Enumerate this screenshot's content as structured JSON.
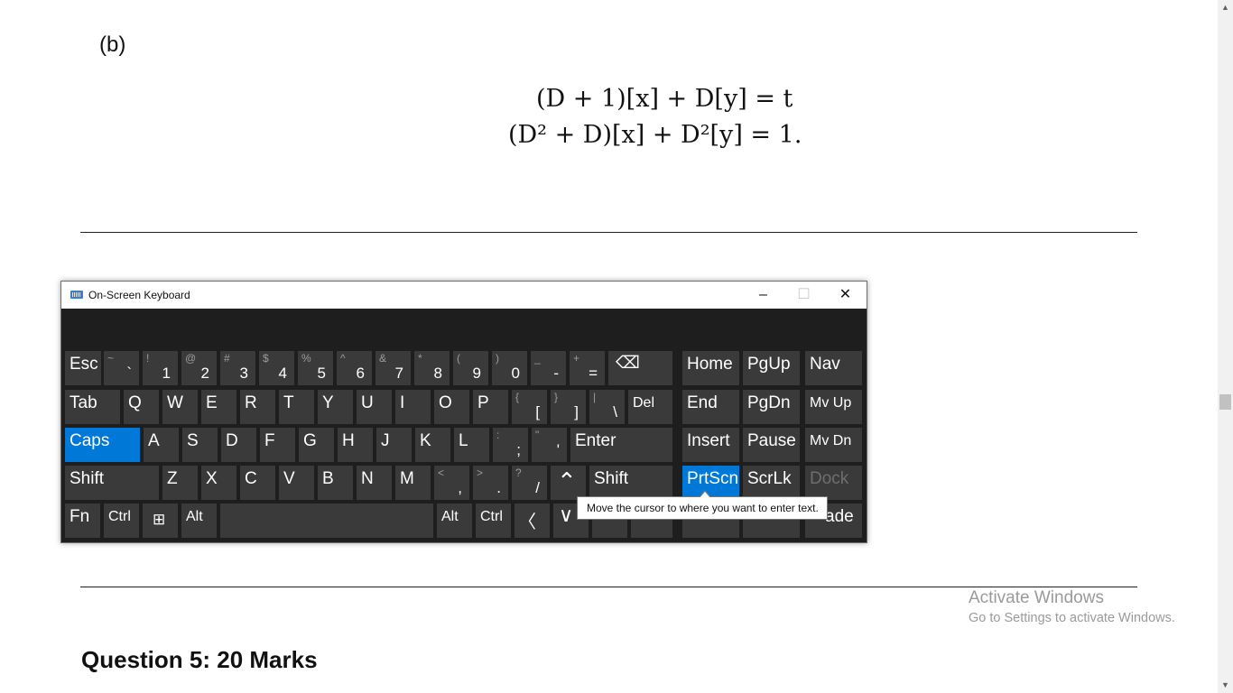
{
  "document": {
    "part_label": "(b)",
    "equation_1": "(D + 1)[x] + D[y] = t",
    "equation_2": "(D² + D)[x] + D²[y] = 1.",
    "question_heading": "Question 5: 20 Marks"
  },
  "watermark": {
    "line1": "Activate Windows",
    "line2": "Go to Settings to activate Windows."
  },
  "osk": {
    "title": "On-Screen Keyboard",
    "minimize": "–",
    "maximize": "☐",
    "close": "✕",
    "tooltip": "Move the cursor to where you want to enter text.",
    "keys": {
      "esc": "Esc",
      "backtick": {
        "sym": "~",
        "main": "`"
      },
      "n1": {
        "sym": "!",
        "main": "1"
      },
      "n2": {
        "sym": "@",
        "main": "2"
      },
      "n3": {
        "sym": "#",
        "main": "3"
      },
      "n4": {
        "sym": "$",
        "main": "4"
      },
      "n5": {
        "sym": "%",
        "main": "5"
      },
      "n6": {
        "sym": "^",
        "main": "6"
      },
      "n7": {
        "sym": "&",
        "main": "7"
      },
      "n8": {
        "sym": "*",
        "main": "8"
      },
      "n9": {
        "sym": "(",
        "main": "9"
      },
      "n0": {
        "sym": ")",
        "main": "0"
      },
      "minus": {
        "sym": "_",
        "main": "-"
      },
      "equals": {
        "sym": "+",
        "main": "="
      },
      "backspace": "⌫",
      "home": "Home",
      "pgup": "PgUp",
      "nav": "Nav",
      "tab": "Tab",
      "q": "Q",
      "w": "W",
      "e": "E",
      "r": "R",
      "t": "T",
      "y": "Y",
      "u": "U",
      "i": "I",
      "o": "O",
      "p": "P",
      "lbracket": {
        "sym": "{",
        "main": "["
      },
      "rbracket": {
        "sym": "}",
        "main": "]"
      },
      "backslash": {
        "sym": "|",
        "main": "\\"
      },
      "del": "Del",
      "end": "End",
      "pgdn": "PgDn",
      "mvup": "Mv Up",
      "caps": "Caps",
      "a": "A",
      "s": "S",
      "d": "D",
      "f": "F",
      "g": "G",
      "h": "H",
      "j": "J",
      "k": "K",
      "l": "L",
      "semicolon": {
        "sym": ":",
        "main": ";"
      },
      "quote": {
        "sym": "\"",
        "main": "'"
      },
      "enter": "Enter",
      "insert": "Insert",
      "pause": "Pause",
      "mvdn": "Mv Dn",
      "shift_l": "Shift",
      "z": "Z",
      "x": "X",
      "c": "C",
      "v": "V",
      "b": "B",
      "n": "N",
      "m": "M",
      "comma": {
        "sym": "<",
        "main": ","
      },
      "period": {
        "sym": ">",
        "main": "."
      },
      "slash": {
        "sym": "?",
        "main": "/"
      },
      "up": "⌃",
      "shift_r": "Shift",
      "prtscn": "PrtScn",
      "scrlk": "ScrLk",
      "dock": "Dock",
      "fn": "Fn",
      "ctrl_l": "Ctrl",
      "win": "⊞",
      "alt_l": "Alt",
      "alt_r": "Alt",
      "ctrl_r": "Ctrl",
      "left": "〈",
      "down": "∨",
      "fade": "ade"
    }
  }
}
